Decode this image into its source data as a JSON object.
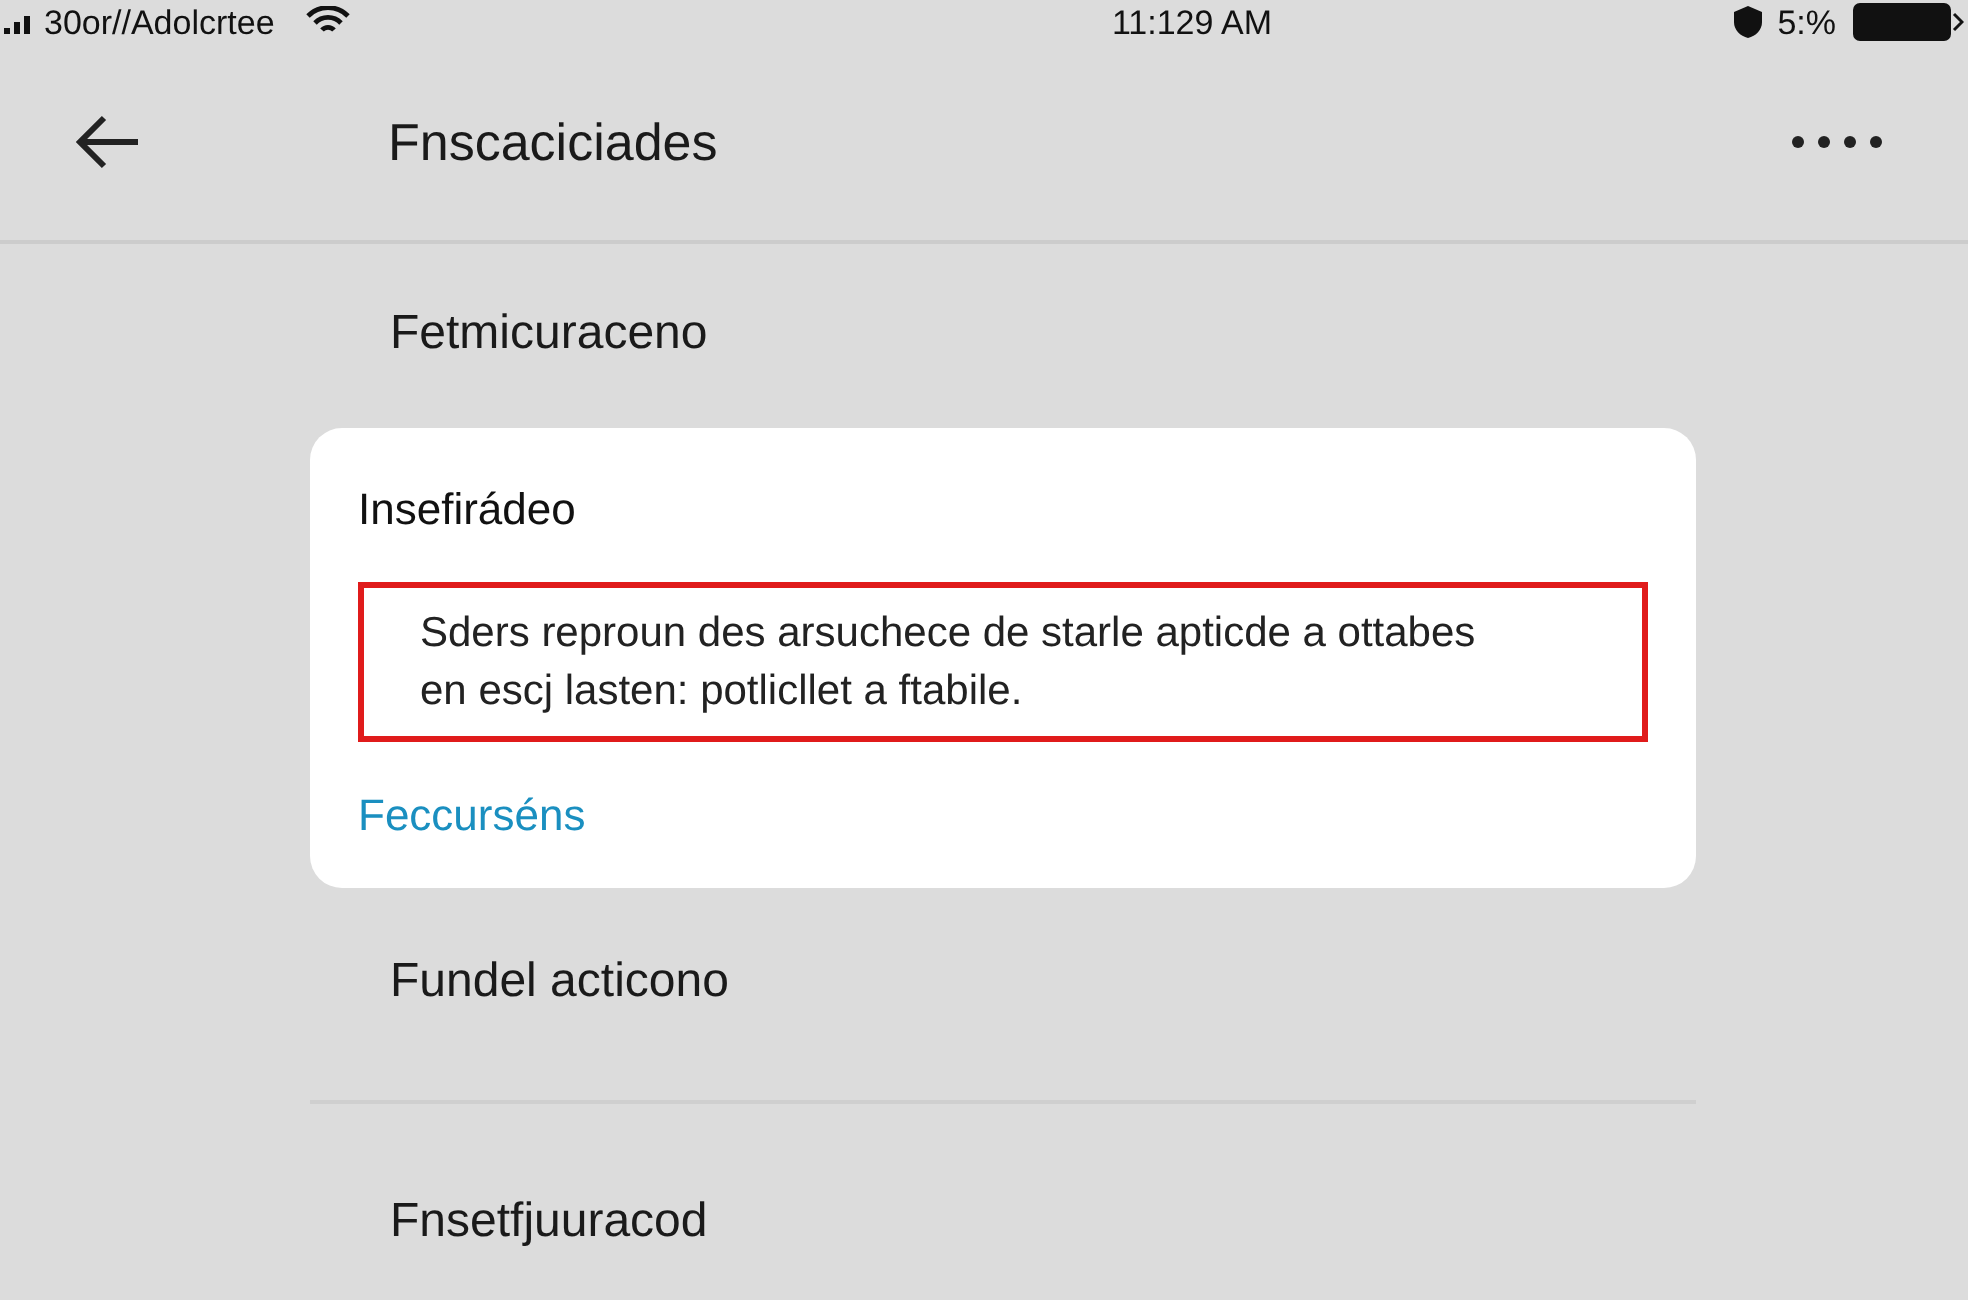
{
  "status_bar": {
    "carrier": "30or//Adolcrtee",
    "time": "11:129 AM",
    "battery": "5:%"
  },
  "header": {
    "title": "Fnscaciciades"
  },
  "items": [
    {
      "kind": "row",
      "label": "Fetmicuraceno"
    },
    {
      "kind": "card",
      "title": "Insefirádeo",
      "message": "Sders reproun des arsuchece de starle apticde a ottabes en escj lasten: potlicllet a ftabile.",
      "link": "Feccurséns"
    },
    {
      "kind": "row",
      "label": "Fundel acticono"
    },
    {
      "kind": "divider"
    },
    {
      "kind": "row",
      "label": "Fnsetfjuuracod"
    }
  ]
}
